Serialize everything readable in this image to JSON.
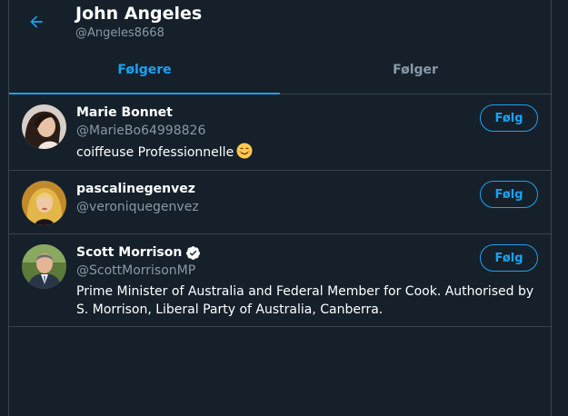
{
  "header": {
    "name": "John Angeles",
    "handle": "@Angeles8668"
  },
  "tabs": [
    {
      "label": "Følgere",
      "active": true
    },
    {
      "label": "Følger",
      "active": false
    }
  ],
  "users": [
    {
      "name": "Marie Bonnet",
      "handle": "@MarieBo64998826",
      "bio": "coiffeuse Professionnelle",
      "bio_emoji": "smiling-face-emoji",
      "verified": false,
      "follow_label": "Følg",
      "avatar": "photo-woman-dark-hair"
    },
    {
      "name": "pascalinegenvez",
      "handle": "@veroniquegenvez",
      "bio": "",
      "verified": false,
      "follow_label": "Følg",
      "avatar": "photo-woman-blonde-hair"
    },
    {
      "name": "Scott Morrison",
      "handle": "@ScottMorrisonMP",
      "bio": "Prime Minister of Australia and Federal Member for Cook. Authorised by S. Morrison, Liberal Party of Australia, Canberra.",
      "verified": true,
      "follow_label": "Følg",
      "avatar": "photo-man-suit"
    }
  ],
  "colors": {
    "background": "#15202b",
    "accent": "#1da1f2",
    "secondary_text": "#8899a6",
    "border": "#38444d"
  }
}
